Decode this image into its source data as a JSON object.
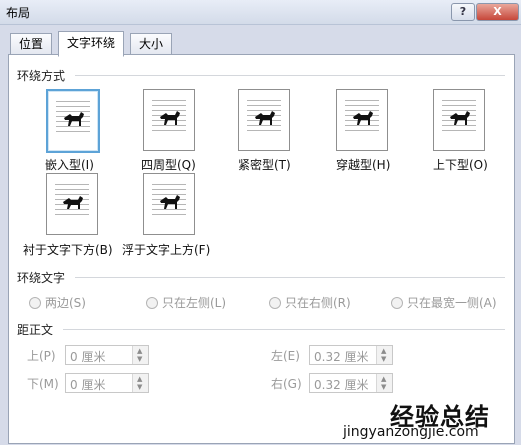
{
  "window": {
    "title": "布局",
    "help_label": "?",
    "close_label": "X"
  },
  "tabs": [
    {
      "label": "位置"
    },
    {
      "label": "文字环绕"
    },
    {
      "label": "大小"
    }
  ],
  "wrap_style": {
    "section_title": "环绕方式",
    "options": [
      {
        "label": "嵌入型(I)",
        "selected": true
      },
      {
        "label": "四周型(Q)"
      },
      {
        "label": "紧密型(T)"
      },
      {
        "label": "穿越型(H)"
      },
      {
        "label": "上下型(O)"
      },
      {
        "label": "衬于文字下方(B)"
      },
      {
        "label": "浮于文字上方(F)"
      }
    ]
  },
  "wrap_text": {
    "section_title": "环绕文字",
    "options": [
      {
        "label": "两边(S)"
      },
      {
        "label": "只在左侧(L)"
      },
      {
        "label": "只在右侧(R)"
      },
      {
        "label": "只在最宽一侧(A)"
      }
    ]
  },
  "distance": {
    "section_title": "距正文",
    "fields": {
      "top": {
        "label": "上(P)",
        "value": "0 厘米"
      },
      "bottom": {
        "label": "下(M)",
        "value": "0 厘米"
      },
      "left": {
        "label": "左(E)",
        "value": "0.32 厘米"
      },
      "right": {
        "label": "右(G)",
        "value": "0.32 厘米"
      }
    }
  },
  "watermark": {
    "title": "经验总结",
    "subtitle": "jingyanzongjie.com"
  },
  "colors": {
    "selected_border": "#5da3d7",
    "disabled_text": "#9a9a9a"
  }
}
